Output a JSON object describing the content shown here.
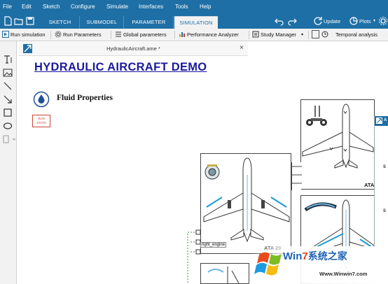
{
  "menu": [
    "File",
    "Edit",
    "Sketch",
    "Configure",
    "Simulate",
    "Interfaces",
    "Tools",
    "Help"
  ],
  "tabs": {
    "items": [
      {
        "label": "SKETCH",
        "active": false
      },
      {
        "label": "SUBMODEL",
        "active": false
      },
      {
        "label": "PARAMETER",
        "active": false
      },
      {
        "label": "SIMULATION",
        "active": true
      }
    ],
    "update_label": "Update",
    "plots_label": "Plots"
  },
  "toolbar": {
    "run_simulation": "Run simulation",
    "run_parameters": "Run Parameters",
    "global_parameters": "Global parameters",
    "performance_analyzer": "Performance Analyzer",
    "study_manager": "Study Manager",
    "temporal_analysis": "Temporal analysis"
  },
  "document": {
    "title": "HydraulicAircraft.ame *",
    "demo_title": "HYDRAULIC AIRCRAFT DEMO",
    "fluid_properties": "Fluid Properties",
    "run_stats_line1": "RUN",
    "run_stats_line2": "STATS"
  },
  "diagram": {
    "ata29_label": "ATA 29",
    "ata32_label": "ATA",
    "right_engine_tag": "right_engine"
  },
  "side_panel": {
    "header": "A",
    "s1": "S",
    "s2": "S"
  },
  "watermark": {
    "title_prefix": "Win",
    "title_num": "7",
    "title_rest": "系统之家",
    "url": "Www.Winwin7.com"
  },
  "colors": {
    "accent": "#1e6fa5",
    "title_blue": "#1a1a9e",
    "run_stats": "#cc4433"
  }
}
